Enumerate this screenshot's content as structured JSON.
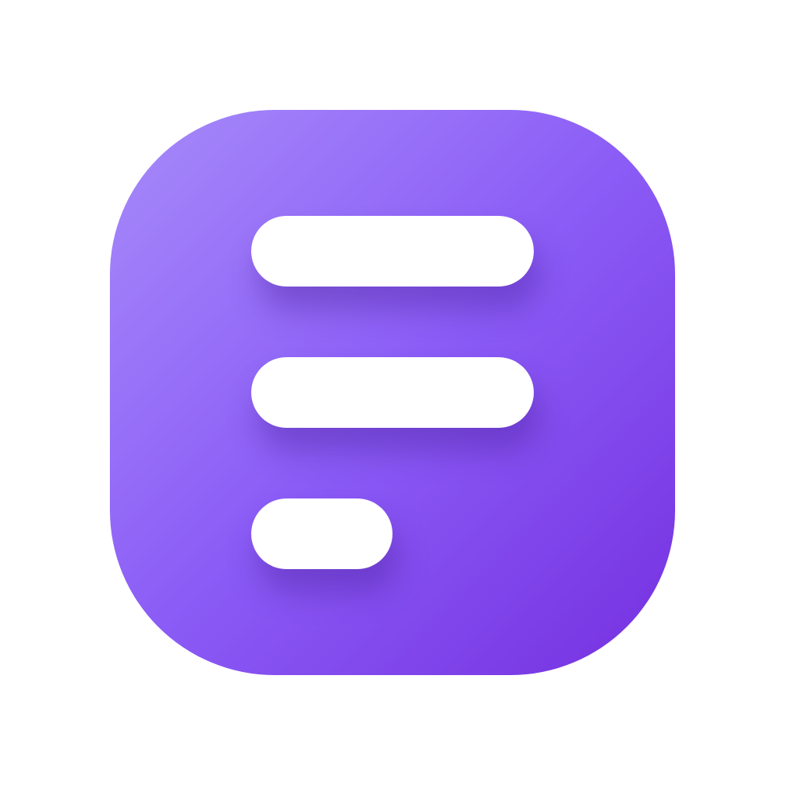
{
  "icon": {
    "name": "menu-lines-app-icon",
    "colors": {
      "gradient_start": "#a78bfa",
      "gradient_mid": "#8b5cf6",
      "gradient_end": "#7530e0",
      "bar_fill": "#ffffff",
      "background": "#ffffff"
    },
    "bars": [
      {
        "name": "top-line"
      },
      {
        "name": "middle-line"
      },
      {
        "name": "short-bottom-line"
      }
    ]
  }
}
